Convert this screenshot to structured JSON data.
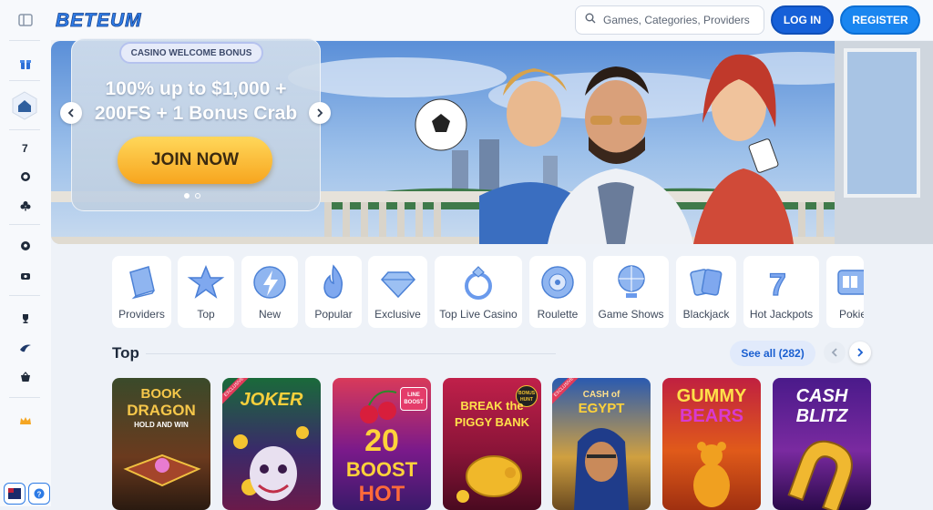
{
  "brand": {
    "logo_text": "BETEUM"
  },
  "header": {
    "search_placeholder": "Games, Categories, Providers",
    "login_label": "LOG IN",
    "register_label": "REGISTER"
  },
  "sidebar": {
    "icons": [
      "panel-toggle-icon",
      "gift-icon",
      "home-icon",
      "seven-icon",
      "chip-icon",
      "club-icon",
      "soccer-icon",
      "video-icon",
      "trophy-icon",
      "swoosh-icon",
      "basket-icon",
      "crown-icon"
    ]
  },
  "banner": {
    "tag": "CASINO WELCOME BONUS",
    "headline_line1": "100% up to $1,000 +",
    "headline_line2": "200FS + 1 Bonus Crab",
    "cta": "JOIN NOW",
    "slides_total": 2,
    "slide_active": 1
  },
  "categories": [
    {
      "label": "Providers",
      "icon": "book-icon"
    },
    {
      "label": "Top",
      "icon": "star-icon"
    },
    {
      "label": "New",
      "icon": "lightning-icon"
    },
    {
      "label": "Popular",
      "icon": "flame-icon"
    },
    {
      "label": "Exclusive",
      "icon": "diamond-icon"
    },
    {
      "label": "Top Live Casino",
      "icon": "ring-icon"
    },
    {
      "label": "Roulette",
      "icon": "roulette-icon"
    },
    {
      "label": "Game Shows",
      "icon": "wheel-icon"
    },
    {
      "label": "Blackjack",
      "icon": "cards-icon"
    },
    {
      "label": "Hot Jackpots",
      "icon": "seven-icon"
    },
    {
      "label": "Pokie",
      "icon": "slot-icon"
    }
  ],
  "top_section": {
    "title": "Top",
    "see_all": "See all (282)",
    "games": [
      {
        "title_line1": "BOOK",
        "title_line2": "DRAGON",
        "subtitle": "HOLD AND WIN",
        "badge": ""
      },
      {
        "title_line1": "JOKER",
        "title_line2": "",
        "subtitle": "",
        "badge": "EXCLUSIVE"
      },
      {
        "title_line1": "20",
        "title_line2": "BOOST",
        "subtitle": "HOT",
        "badge": "LINE BOOST"
      },
      {
        "title_line1": "BREAK the",
        "title_line2": "PIGGY BANK",
        "subtitle": "",
        "badge": "BONUS HUNT"
      },
      {
        "title_line1": "CASH of",
        "title_line2": "EGYPT",
        "subtitle": "",
        "badge": "EXCLUSIVE"
      },
      {
        "title_line1": "GUMMY",
        "title_line2": "BEARS",
        "subtitle": "",
        "badge": ""
      },
      {
        "title_line1": "CASH",
        "title_line2": "BLITZ",
        "subtitle": "",
        "badge": ""
      }
    ]
  },
  "colors": {
    "primary": "#1660d8",
    "register": "#1a86f0",
    "cta": "#f7a51e"
  }
}
